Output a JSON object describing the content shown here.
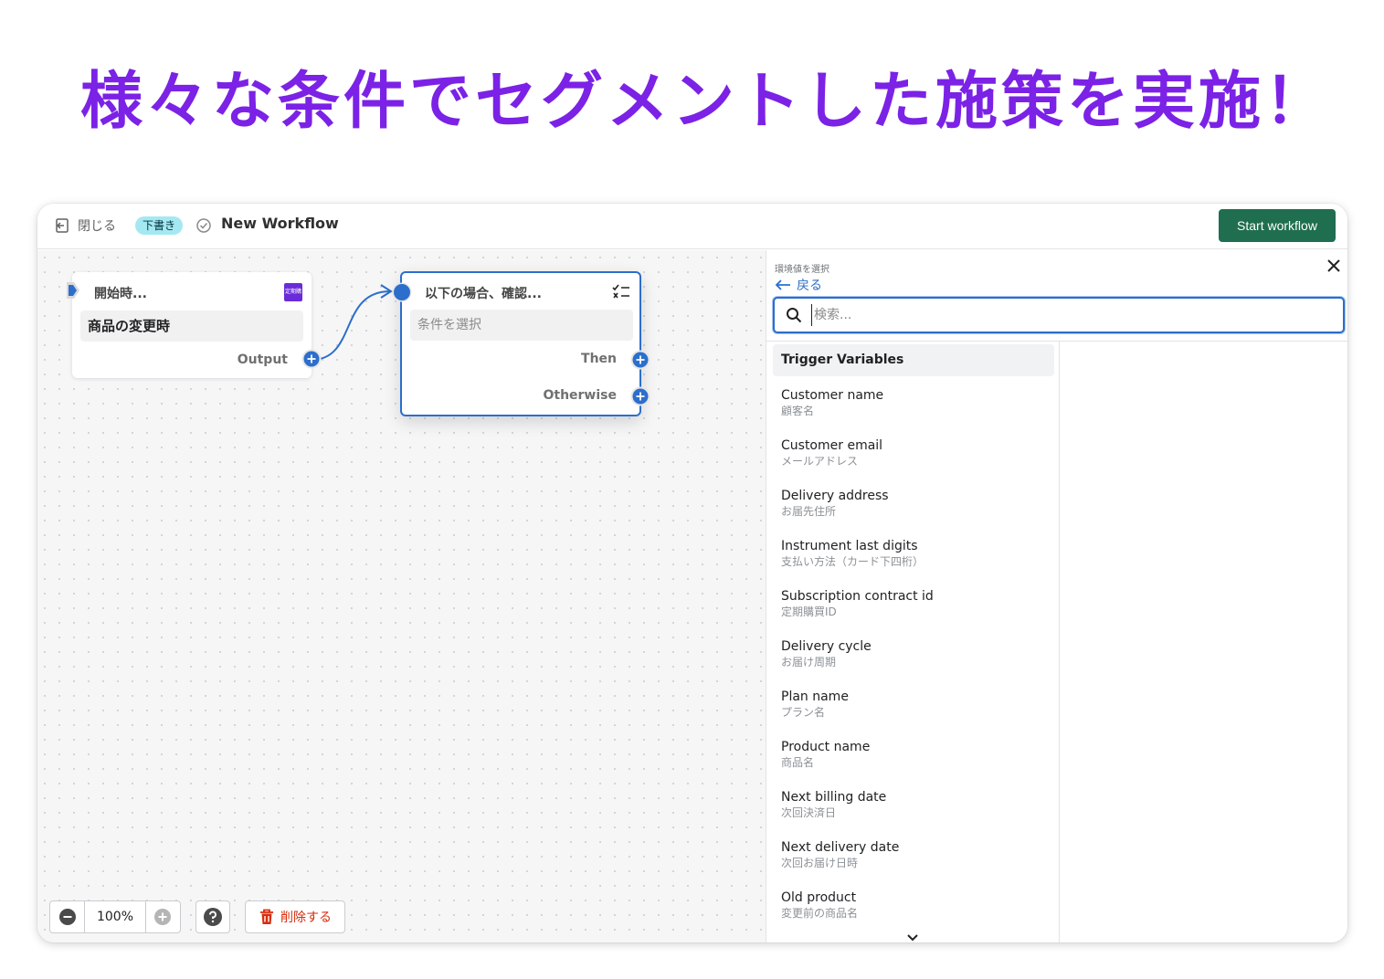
{
  "headline": "様々な条件でセグメントした施策を実施！",
  "topbar": {
    "close_label": "閉じる",
    "status_badge": "下書き",
    "workflow_title": "New Workflow",
    "start_button": "Start workflow"
  },
  "canvas": {
    "trigger_node": {
      "header": "開始時...",
      "field": "商品の変更時",
      "output_label": "Output",
      "app_logo_text": "定期購買"
    },
    "condition_node": {
      "header": "以下の場合、確認...",
      "field_placeholder": "条件を選択",
      "then_label": "Then",
      "otherwise_label": "Otherwise"
    },
    "zoom_level": "100%",
    "delete_button": "削除する"
  },
  "panel": {
    "caption": "環境値を選択",
    "back_label": "戻る",
    "search_placeholder": "検索...",
    "section_header": "Trigger Variables",
    "items": [
      {
        "name": "Customer name",
        "sub": "顧客名"
      },
      {
        "name": "Customer email",
        "sub": "メールアドレス"
      },
      {
        "name": "Delivery address",
        "sub": "お届先住所"
      },
      {
        "name": "Instrument last digits",
        "sub": "支払い方法（カード下四桁）"
      },
      {
        "name": "Subscription contract id",
        "sub": "定期購買ID"
      },
      {
        "name": "Delivery cycle",
        "sub": "お届け周期"
      },
      {
        "name": "Plan name",
        "sub": "プラン名"
      },
      {
        "name": "Product name",
        "sub": "商品名"
      },
      {
        "name": "Next billing date",
        "sub": "次回決済日"
      },
      {
        "name": "Next delivery date",
        "sub": "次回お届け日時"
      },
      {
        "name": "Old product",
        "sub": "変更前の商品名"
      }
    ]
  },
  "colors": {
    "headline": "#7b22e6",
    "primary_button": "#1f6e4f",
    "accent_blue": "#2c6ecb",
    "badge": "#a4e8f2",
    "delete": "#d72c0d"
  }
}
